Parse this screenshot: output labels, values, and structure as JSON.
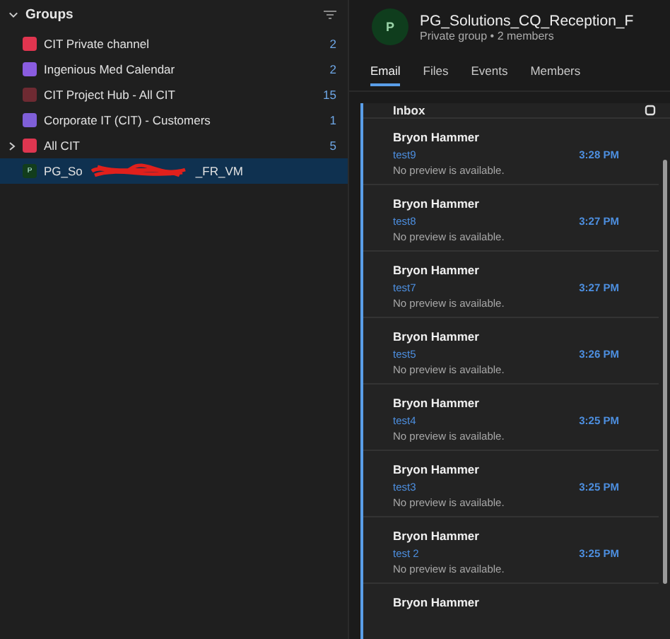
{
  "sidebar": {
    "title": "Groups",
    "expanded": true,
    "items": [
      {
        "name": "CIT Private channel",
        "count": "2",
        "color": "#e0354f",
        "selected": false,
        "expandable": false
      },
      {
        "name": "Ingenious Med Calendar",
        "count": "2",
        "color": "#8a5ce0",
        "selected": false,
        "expandable": false
      },
      {
        "name": "CIT Project Hub - All CIT",
        "count": "15",
        "color": "#6e2a32",
        "selected": false,
        "expandable": false
      },
      {
        "name": "Corporate IT (CIT) - Customers",
        "count": "1",
        "color": "#7f5fd8",
        "selected": false,
        "expandable": false
      },
      {
        "name": "All CIT",
        "count": "5",
        "color": "#de3650",
        "selected": false,
        "expandable": true
      },
      {
        "name": "PG_So",
        "name_end": "_FR_VM",
        "avatar": "P",
        "color": "#123d1c",
        "selected": true,
        "expandable": false,
        "redacted": true
      }
    ]
  },
  "group": {
    "avatar": "P",
    "title": "PG_Solutions_CQ_Reception_F",
    "subtitle": "Private group • 2 members"
  },
  "tabs": [
    {
      "label": "Email",
      "selected": true
    },
    {
      "label": "Files",
      "selected": false
    },
    {
      "label": "Events",
      "selected": false
    },
    {
      "label": "Members",
      "selected": false
    }
  ],
  "inbox": {
    "title": "Inbox",
    "messages": [
      {
        "sender": "Bryon Hammer",
        "subject": "test9",
        "time": "3:28 PM",
        "preview": "No preview is available."
      },
      {
        "sender": "Bryon Hammer",
        "subject": "test8",
        "time": "3:27 PM",
        "preview": "No preview is available."
      },
      {
        "sender": "Bryon Hammer",
        "subject": "test7",
        "time": "3:27 PM",
        "preview": "No preview is available."
      },
      {
        "sender": "Bryon Hammer",
        "subject": "test5",
        "time": "3:26 PM",
        "preview": "No preview is available."
      },
      {
        "sender": "Bryon Hammer",
        "subject": "test4",
        "time": "3:25 PM",
        "preview": "No preview is available."
      },
      {
        "sender": "Bryon Hammer",
        "subject": "test3",
        "time": "3:25 PM",
        "preview": "No preview is available."
      },
      {
        "sender": "Bryon Hammer",
        "subject": "test 2",
        "time": "3:25 PM",
        "preview": "No preview is available."
      },
      {
        "sender": "Bryon Hammer"
      }
    ]
  }
}
